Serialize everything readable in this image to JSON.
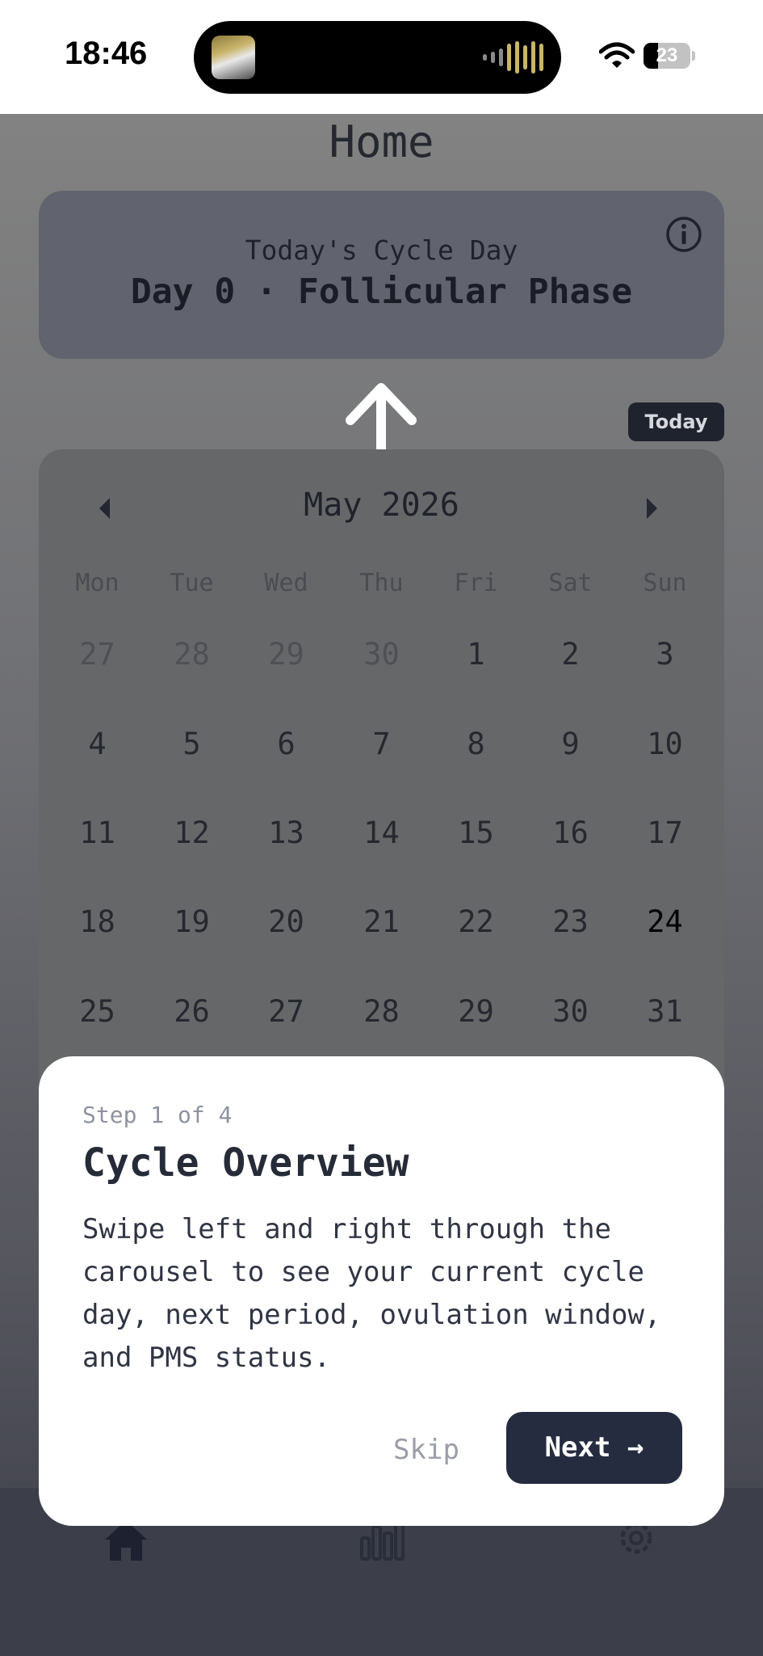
{
  "status_bar": {
    "time": "18:46",
    "battery": "23"
  },
  "page": {
    "title": "Home"
  },
  "cycle_card": {
    "subtitle": "Today's Cycle Day",
    "main": "Day 0 · Follicular Phase"
  },
  "today_button": "Today",
  "calendar": {
    "month": "May 2026",
    "weekdays": [
      "Mon",
      "Tue",
      "Wed",
      "Thu",
      "Fri",
      "Sat",
      "Sun"
    ],
    "weeks": [
      [
        "27",
        "28",
        "29",
        "30",
        "1",
        "2",
        "3"
      ],
      [
        "4",
        "5",
        "6",
        "7",
        "8",
        "9",
        "10"
      ],
      [
        "11",
        "12",
        "13",
        "14",
        "15",
        "16",
        "17"
      ],
      [
        "18",
        "19",
        "20",
        "21",
        "22",
        "23",
        "24"
      ],
      [
        "25",
        "26",
        "27",
        "28",
        "29",
        "30",
        "31"
      ]
    ],
    "today_day": "24"
  },
  "onboarding": {
    "step": "Step 1 of 4",
    "title": "Cycle Overview",
    "body": "Swipe left and right through the carousel to see your current cycle day, next period, ovulation window, and PMS status.",
    "skip": "Skip",
    "next": "Next →"
  },
  "nav": {
    "items": [
      "home-icon",
      "bar-chart-icon",
      "gear-icon"
    ]
  }
}
